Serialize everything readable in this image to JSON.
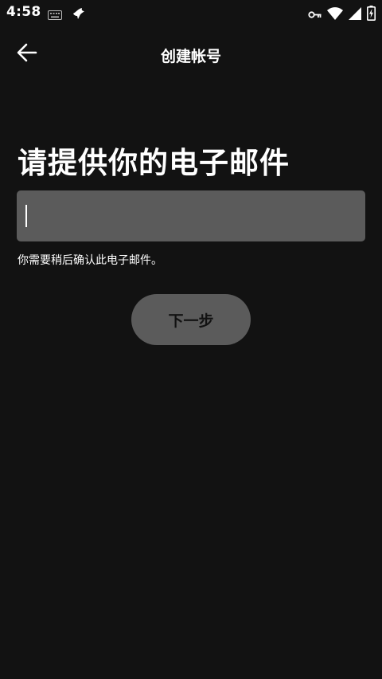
{
  "status_bar": {
    "time": "4:58",
    "left_icons": [
      "keyboard-icon",
      "bird-icon"
    ],
    "right_icons": [
      "vpn-key-icon",
      "wifi-icon",
      "signal-icon",
      "battery-charging-icon"
    ]
  },
  "app_bar": {
    "title": "创建帐号",
    "back_icon": "arrow-back-icon"
  },
  "main": {
    "heading": "请提供你的电子邮件",
    "email_input": {
      "value": "",
      "placeholder": ""
    },
    "hint": "你需要稍后确认此电子邮件。",
    "next_button_label": "下一步"
  },
  "colors": {
    "background": "#121212",
    "input_background": "#5b5b5b",
    "button_background": "#5b5b5b",
    "button_text": "#121212",
    "text": "#ffffff"
  }
}
